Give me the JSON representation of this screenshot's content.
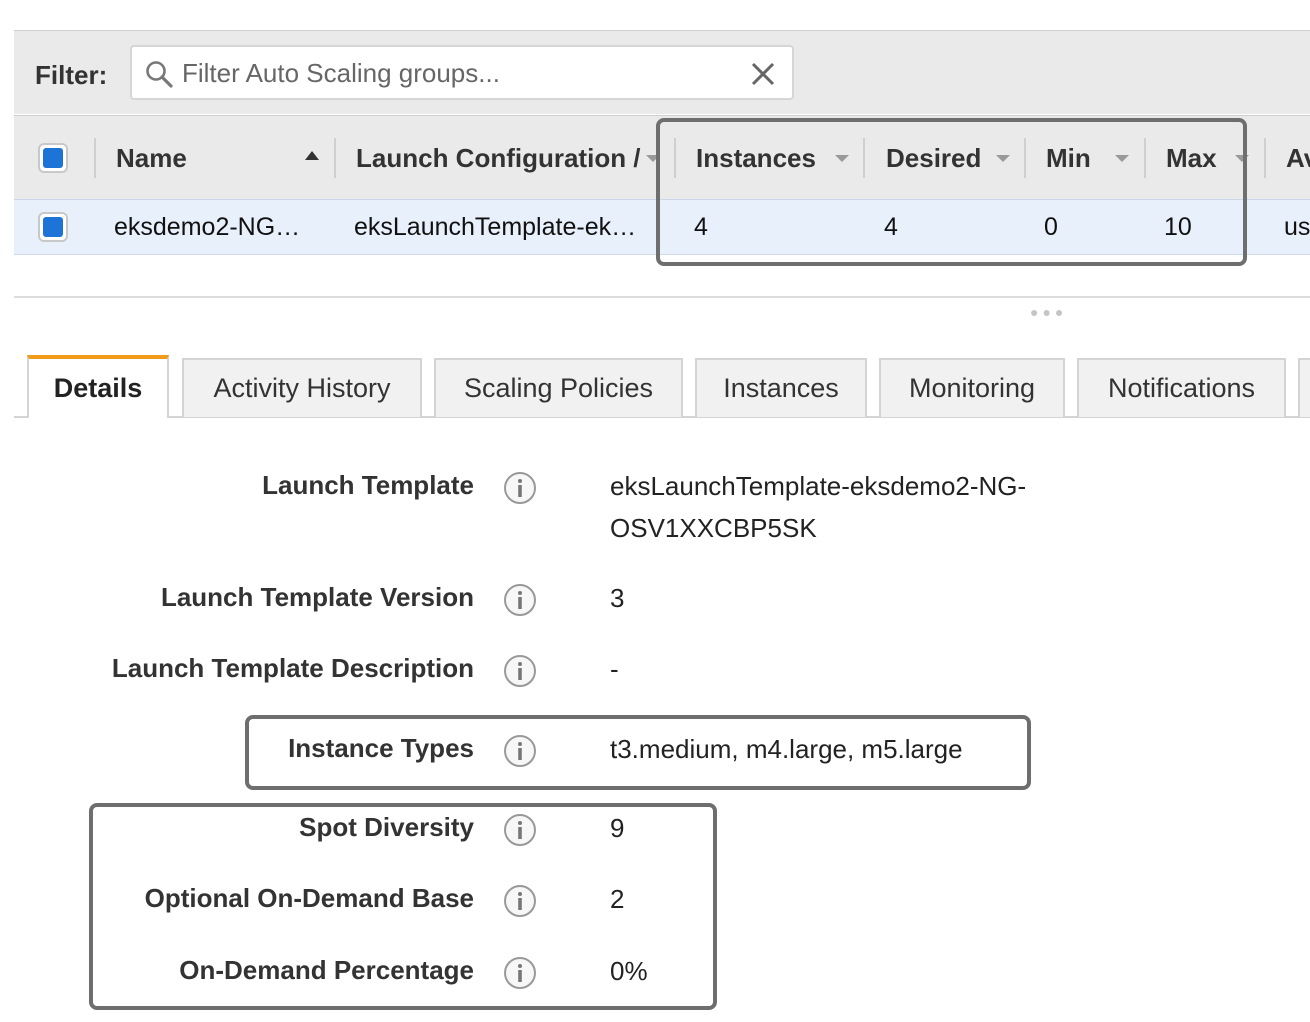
{
  "filter": {
    "label": "Filter:",
    "placeholder": "Filter Auto Scaling groups...",
    "value": ""
  },
  "table": {
    "columns": {
      "name": "Name",
      "launch_config": "Launch Configuration /",
      "instances": "Instances",
      "desired": "Desired",
      "min": "Min",
      "max": "Max",
      "az": "Av"
    },
    "row": {
      "name": "eksdemo2-NG…",
      "launch_config": "eksLaunchTemplate-ek…",
      "instances": "4",
      "desired": "4",
      "min": "0",
      "max": "10",
      "az": "us"
    }
  },
  "tabs": [
    {
      "label": "Details",
      "active": true
    },
    {
      "label": "Activity History"
    },
    {
      "label": "Scaling Policies"
    },
    {
      "label": "Instances"
    },
    {
      "label": "Monitoring"
    },
    {
      "label": "Notifications"
    }
  ],
  "details": [
    {
      "label": "Launch Template",
      "value": "eksLaunchTemplate-eksdemo2-NG-\nOSV1XXCBP5SK"
    },
    {
      "label": "Launch Template Version",
      "value": "3"
    },
    {
      "label": "Launch Template Description",
      "value": "-"
    },
    {
      "label": "Instance Types",
      "value": "t3.medium, m4.large, m5.large"
    },
    {
      "label": "Spot Diversity",
      "value": "9"
    },
    {
      "label": "Optional On-Demand Base",
      "value": "2"
    },
    {
      "label": "On-Demand Percentage",
      "value": "0%"
    }
  ],
  "colors": {
    "accent_tab": "#f29a1a",
    "checkbox": "#1e74d6",
    "selected_row": "#e8f0fb",
    "highlight_border": "#6e6e6e"
  }
}
